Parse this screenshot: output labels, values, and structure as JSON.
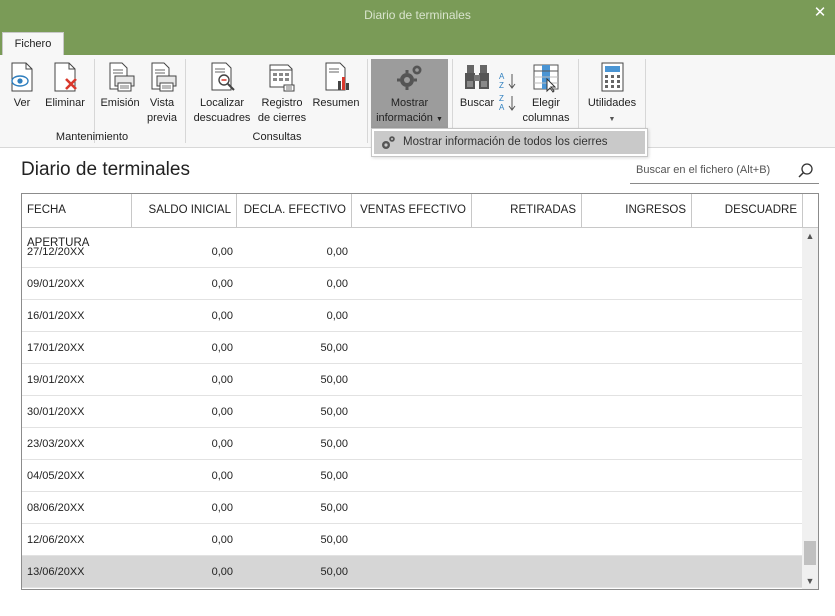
{
  "window": {
    "title": "Diario de terminales",
    "close_glyph": "✕"
  },
  "tabs": {
    "active": "Fichero"
  },
  "ribbon": {
    "mantenimiento": {
      "label": "Mantenimiento",
      "ver": "Ver",
      "eliminar": "Eliminar",
      "emision": "Emisión",
      "vista_line1": "Vista",
      "vista_line2": "previa"
    },
    "consultas": {
      "label": "Consultas",
      "localizar_line1": "Localizar",
      "localizar_line2": "descuadres",
      "registro_line1": "Registro",
      "registro_line2": "de cierres",
      "resumen": "Resumen"
    },
    "mostrar_line1": "Mostrar",
    "mostrar_line2": "información",
    "buscar": "Buscar",
    "elegir_line1": "Elegir",
    "elegir_line2": "columnas",
    "utilidades": "Utilidades"
  },
  "dropdown": {
    "item": "Mostrar información de todos los cierres"
  },
  "page": {
    "title": "Diario de terminales"
  },
  "search": {
    "placeholder": "Buscar en el fichero (Alt+B)"
  },
  "table": {
    "columns": [
      "FECHA APERTURA",
      "SALDO INICIAL",
      "DECLA. EFECTIVO",
      "VENTAS EFECTIVO",
      "RETIRADAS",
      "INGRESOS",
      "DESCUADRE"
    ],
    "rows": [
      {
        "fecha": "27/12/20XX",
        "saldo": "0,00",
        "decla": "0,00"
      },
      {
        "fecha": "09/01/20XX",
        "saldo": "0,00",
        "decla": "0,00"
      },
      {
        "fecha": "16/01/20XX",
        "saldo": "0,00",
        "decla": "0,00"
      },
      {
        "fecha": "17/01/20XX",
        "saldo": "0,00",
        "decla": "50,00"
      },
      {
        "fecha": "19/01/20XX",
        "saldo": "0,00",
        "decla": "50,00"
      },
      {
        "fecha": "30/01/20XX",
        "saldo": "0,00",
        "decla": "50,00"
      },
      {
        "fecha": "23/03/20XX",
        "saldo": "0,00",
        "decla": "50,00"
      },
      {
        "fecha": "04/05/20XX",
        "saldo": "0,00",
        "decla": "50,00"
      },
      {
        "fecha": "08/06/20XX",
        "saldo": "0,00",
        "decla": "50,00"
      },
      {
        "fecha": "12/06/20XX",
        "saldo": "0,00",
        "decla": "50,00"
      },
      {
        "fecha": "13/06/20XX",
        "saldo": "0,00",
        "decla": "50,00"
      }
    ]
  },
  "icons": {
    "ver": "eye-document-icon",
    "eliminar": "delete-document-icon",
    "emision": "printer-icon",
    "vista_previa": "print-preview-icon",
    "localizar": "search-document-icon",
    "registro": "calendar-register-icon",
    "resumen": "chart-document-icon",
    "mostrar": "gears-icon",
    "buscar": "binoculars-icon",
    "ordenar_az": "sort-ascending-icon",
    "ordenar_za": "sort-descending-icon",
    "elegir": "columns-icon",
    "utilidades": "calculator-icon",
    "search": "search-icon"
  },
  "colors": {
    "titlebar": "#7a9b57",
    "selected_row": "#d6d6d6",
    "active_ribbon_button": "#9c9c9c",
    "delete_red": "#d9382c",
    "eye_blue": "#2f7fbf"
  }
}
